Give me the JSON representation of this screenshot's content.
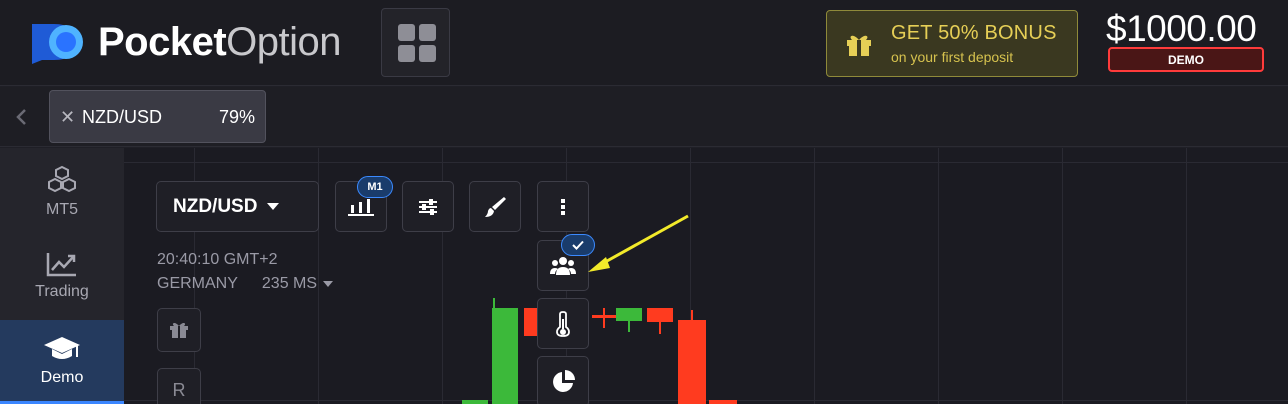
{
  "header": {
    "logo_bold": "Pocket",
    "logo_light": "Option",
    "bonus_title": "GET 50% BONUS",
    "bonus_subtitle": "on your first deposit",
    "balance": "$1000.00",
    "account_mode": "DEMO"
  },
  "tabs": [
    {
      "asset": "NZD/USD",
      "payout": "79%"
    }
  ],
  "sidebar": {
    "items": [
      {
        "label": "MT5",
        "icon": "cubes-icon"
      },
      {
        "label": "Trading",
        "icon": "chart-line-icon"
      },
      {
        "label": "Demo",
        "icon": "graduation-cap-icon",
        "active": true
      }
    ]
  },
  "chart_toolbar": {
    "pair": "NZD/USD",
    "timeframe_badge": "M1",
    "time": "20:40:10 GMT+2",
    "region": "GERMANY",
    "ping": "235 MS",
    "reset_label": "R"
  },
  "colors": {
    "up": "#3cb93a",
    "down": "#ff3b1f",
    "accent": "#3b8aff",
    "bonus": "#e6cf56",
    "arrow": "#f2ea2a"
  }
}
